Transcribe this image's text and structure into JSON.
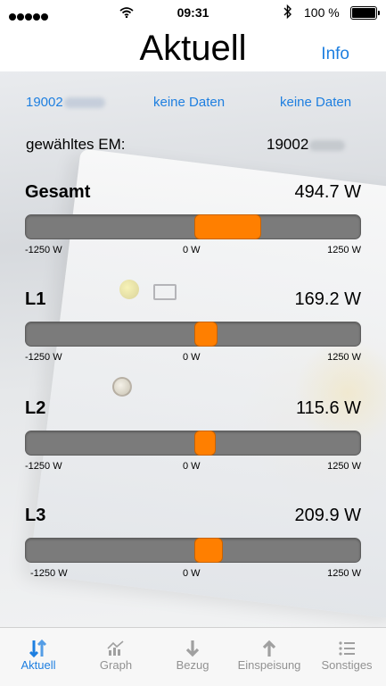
{
  "status_bar": {
    "time": "09:31",
    "battery": "100 %"
  },
  "nav": {
    "title": "Aktuell",
    "info_label": "Info"
  },
  "top_links": {
    "serial": "19002",
    "link_a": "keine Daten",
    "link_b": "keine Daten"
  },
  "selection": {
    "label": "gewähltes EM:",
    "value": "19002"
  },
  "meters": [
    {
      "label": "Gesamt",
      "value": "494.7 W",
      "watts": 494.7,
      "min": "-1250 W",
      "zero": "0 W",
      "max": "1250 W"
    },
    {
      "label": "L1",
      "value": "169.2 W",
      "watts": 169.2,
      "min": "-1250 W",
      "zero": "0 W",
      "max": "1250 W"
    },
    {
      "label": "L2",
      "value": "115.6 W",
      "watts": 115.6,
      "min": "-1250 W",
      "zero": "0 W",
      "max": "1250 W"
    },
    {
      "label": "L3",
      "value": "209.9 W",
      "watts": 209.9,
      "min": "-1250 W",
      "zero": "0 W",
      "max": "1250 W"
    }
  ],
  "scale": {
    "min_w": -1250,
    "max_w": 1250
  },
  "colors": {
    "accent": "#1e7fe0",
    "bar_fill": "#ff7f00",
    "bar_track": "#7b7b7b"
  },
  "tabs": [
    {
      "label": "Aktuell",
      "icon": "arrows-updown-icon",
      "active": true
    },
    {
      "label": "Graph",
      "icon": "graph-icon",
      "active": false
    },
    {
      "label": "Bezug",
      "icon": "arrow-down-icon",
      "active": false
    },
    {
      "label": "Einspeisung",
      "icon": "arrow-up-icon",
      "active": false
    },
    {
      "label": "Sonstiges",
      "icon": "list-icon",
      "active": false
    }
  ]
}
